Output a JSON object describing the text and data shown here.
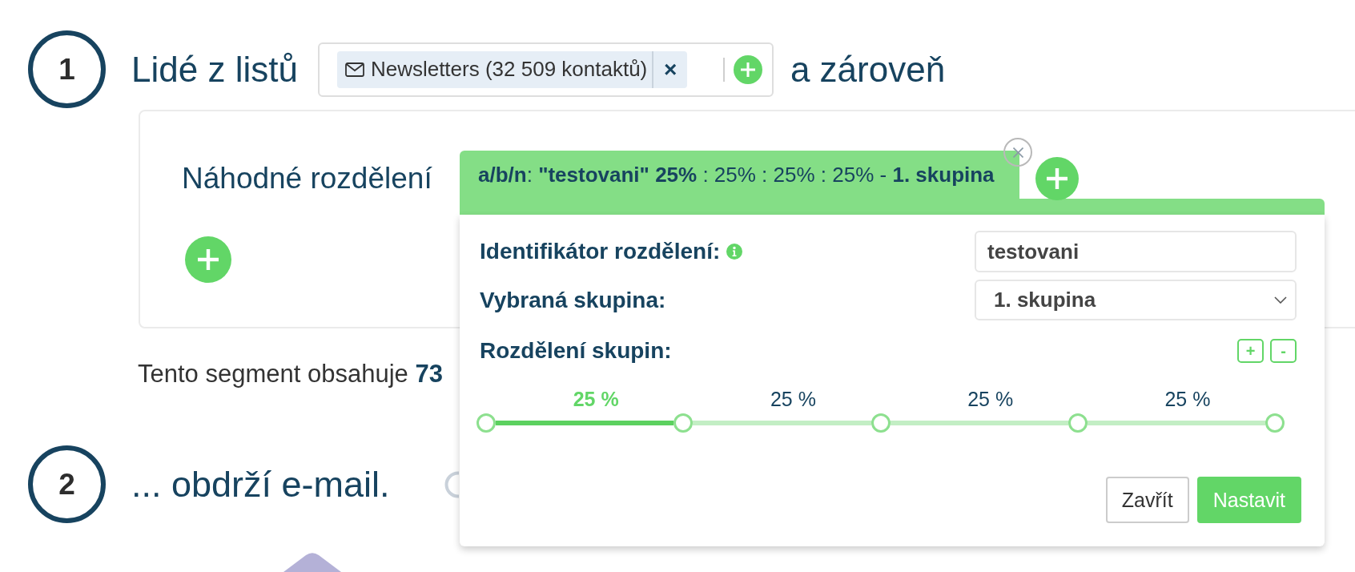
{
  "step_1": {
    "number": "1",
    "label": "Lidé z listů",
    "lists_field": {
      "tags": [
        {
          "text": "Newsletters (32 509 kontaktů)",
          "remove": "×"
        }
      ]
    },
    "connector": "a zároveň"
  },
  "condition_card": {
    "title": "Náhodné rozdělení"
  },
  "segment_summary": "Tento segment obsahuje **73**",
  "step_2": {
    "number": "2",
    "label": "... obdrží e-mail."
  },
  "split_popup": {
    "summary": "**a/b/n**: **\"testovani\" 25%** : 25% : 25% : 25% - **1. skupina**",
    "fields": [
      {
        "kind": "text",
        "label": "Identifikátor rozdělení:",
        "info": true,
        "value": "testovani"
      },
      {
        "kind": "select",
        "label": "Vybraná skupina:",
        "info": false,
        "value": "1. skupina"
      }
    ],
    "distribution": {
      "label": "Rozdělení skupin:",
      "add": "+",
      "remove": "-",
      "groups": [
        {
          "label": "25 %",
          "selected": true
        },
        {
          "label": "25 %",
          "selected": false
        },
        {
          "label": "25 %",
          "selected": false
        },
        {
          "label": "25 %",
          "selected": false
        }
      ],
      "handles": [
        {
          "level": 0
        },
        {
          "level": 0.25
        },
        {
          "level": 0.5
        },
        {
          "level": 0.75
        },
        {
          "level": 1
        }
      ]
    },
    "buttons": [
      {
        "kind": "secondary",
        "label": "Zavřít"
      },
      {
        "kind": "primary",
        "label": "Nastavit"
      }
    ]
  }
}
